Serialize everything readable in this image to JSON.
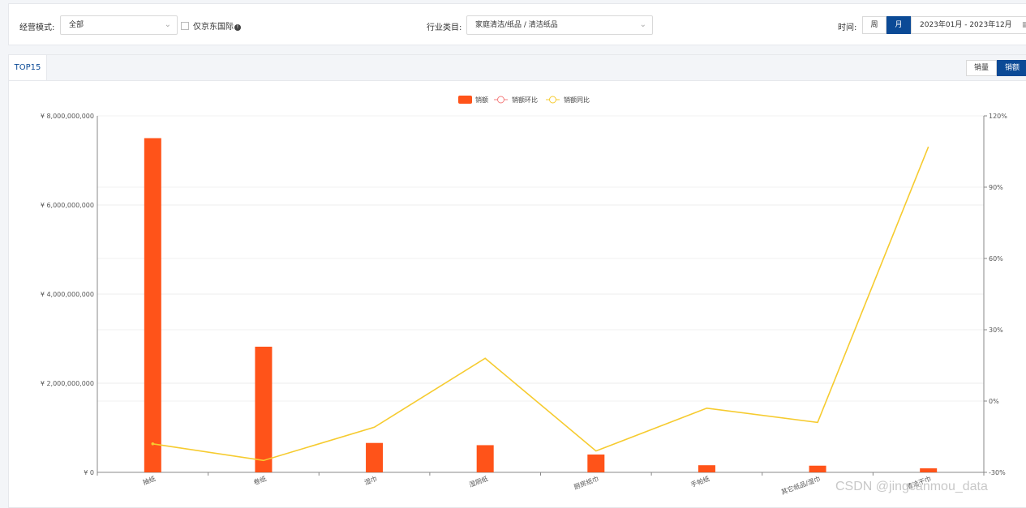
{
  "filters": {
    "mode_label": "经营模式:",
    "mode_value": "全部",
    "jd_intl_label": "仅京东国际",
    "industry_label": "行业类目:",
    "industry_value": "家庭清洁/纸品 / 清洁纸品",
    "time_label": "时间:",
    "week_label": "周",
    "month_label": "月",
    "date_range": "2023年01月 - 2023年12月"
  },
  "panel": {
    "tab_label": "TOP15",
    "toggle_qty": "销量",
    "toggle_amount": "销额"
  },
  "chart_data": {
    "type": "bar",
    "categories": [
      "抽纸",
      "卷纸",
      "湿巾",
      "湿厕纸",
      "厨房纸巾",
      "手帕纸",
      "其它纸品/湿巾",
      "清洁干巾"
    ],
    "series": [
      {
        "name": "销额",
        "type": "bar",
        "axis": "left",
        "color": "#ff5319",
        "values": [
          7500000000,
          2820000000,
          660000000,
          610000000,
          400000000,
          160000000,
          150000000,
          90000000
        ]
      },
      {
        "name": "销额环比",
        "type": "line",
        "axis": "right",
        "color": "#f47c7c",
        "values": []
      },
      {
        "name": "销额同比",
        "type": "line",
        "axis": "right",
        "color": "#f6cb2f",
        "values": [
          -18,
          -25,
          -11,
          18,
          -21,
          -3,
          -9,
          107
        ]
      }
    ],
    "y_left": {
      "min": 0,
      "max": 8000000000,
      "ticks": [
        "¥ 0",
        "¥ 2,000,000,000",
        "¥ 4,000,000,000",
        "¥ 6,000,000,000",
        "¥ 8,000,000,000"
      ]
    },
    "y_right": {
      "min": -30,
      "max": 120,
      "ticks": [
        "-30%",
        "0%",
        "30%",
        "60%",
        "90%",
        "120%"
      ]
    },
    "grid": true,
    "legend_position": "top-center"
  },
  "watermark": "CSDN @jingcanmou_data"
}
